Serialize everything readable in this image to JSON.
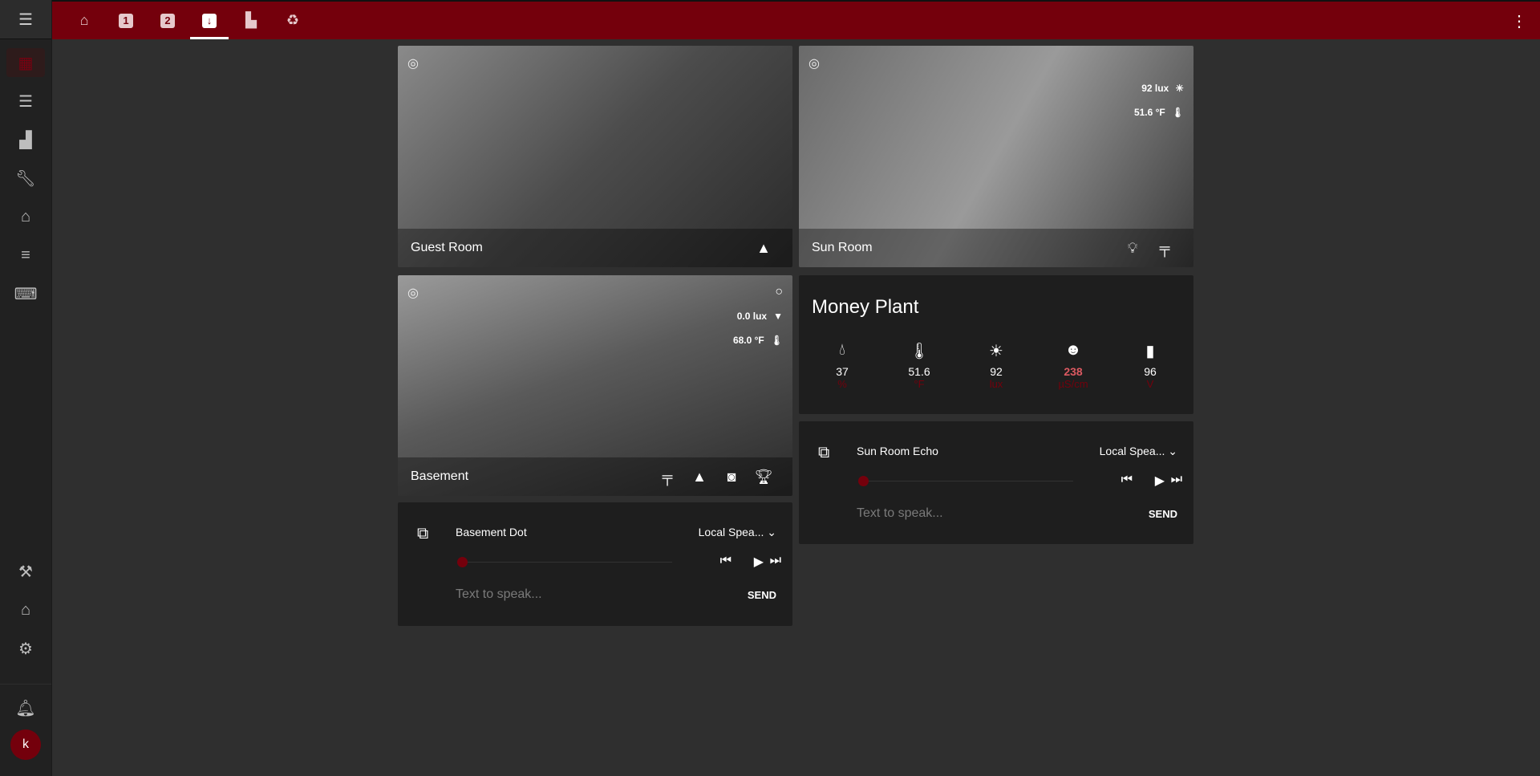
{
  "sidebar": {
    "avatar": "k",
    "items": [
      "dashboard",
      "logbook",
      "history",
      "developer-tools",
      "hacs",
      "energy",
      "terminal"
    ],
    "bottom": [
      "hammer",
      "supervisor",
      "settings",
      "notifications"
    ]
  },
  "tabs": [
    {
      "name": "home"
    },
    {
      "name": "view-1",
      "label": "1"
    },
    {
      "name": "view-2",
      "label": "2"
    },
    {
      "name": "download",
      "active": true
    },
    {
      "name": "chart"
    },
    {
      "name": "recycle"
    }
  ],
  "cameras": {
    "guest": {
      "name": "Guest Room"
    },
    "sun": {
      "name": "Sun Room",
      "lux": "92 lux",
      "temp": "51.6 °F"
    },
    "basement": {
      "name": "Basement",
      "lux": "0.0 lux",
      "temp": "68.0 °F"
    }
  },
  "plant": {
    "title": "Money Plant",
    "attrs": [
      {
        "icon": "water",
        "value": "37",
        "unit": "%"
      },
      {
        "icon": "thermometer",
        "value": "51.6",
        "unit": "°F"
      },
      {
        "icon": "sun",
        "value": "92",
        "unit": "lux"
      },
      {
        "icon": "fertilizer",
        "value": "238",
        "unit": "µS/cm",
        "warn": true
      },
      {
        "icon": "battery",
        "value": "96",
        "unit": "V"
      }
    ]
  },
  "players": {
    "sun": {
      "title": "Sun Room Echo",
      "source": "Local Spea...",
      "tts": "Text to speak...",
      "send": "SEND",
      "progress": 0
    },
    "basement": {
      "title": "Basement Dot",
      "source": "Local Spea...",
      "tts": "Text to speak...",
      "send": "SEND",
      "progress": 0
    }
  },
  "colors": {
    "accent": "#74000c",
    "warn": "#db5961"
  }
}
